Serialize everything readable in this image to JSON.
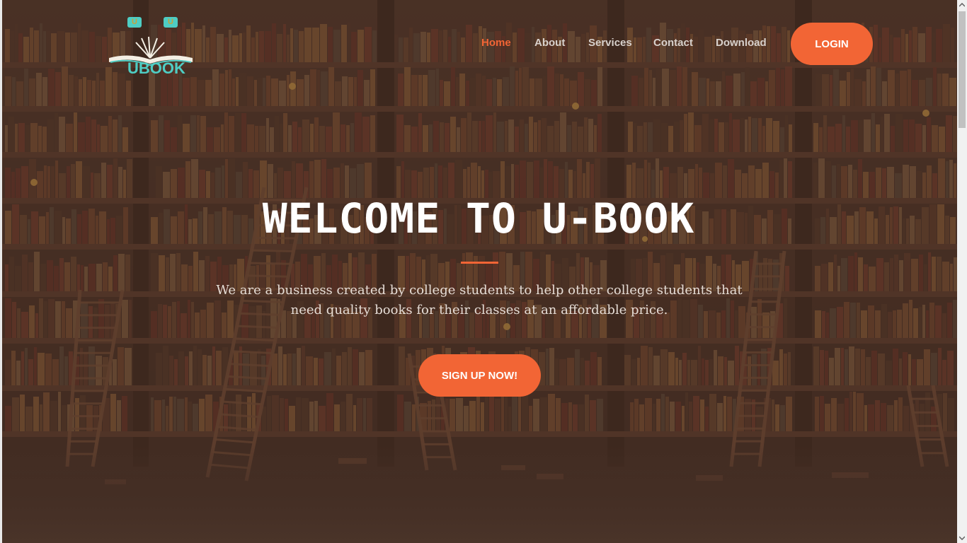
{
  "brand": {
    "logo_text": "UBOOK",
    "logo_tab_left": "U",
    "logo_tab_right": "U",
    "accent_color": "#f26535",
    "logo_color": "#4ecdc4"
  },
  "nav": {
    "items": [
      {
        "label": "Home",
        "active": true
      },
      {
        "label": "About",
        "active": false
      },
      {
        "label": "Services",
        "active": false
      },
      {
        "label": "Contact",
        "active": false
      },
      {
        "label": "Download",
        "active": false
      }
    ],
    "login_label": "LOGIN"
  },
  "hero": {
    "headline": "WELCOME TO U-BOOK",
    "tagline": "We are a business created by college students to help other college students that need quality books for their classes at an affordable price.",
    "cta_label": "SIGN UP NOW!",
    "background_icon": "library-bookshelves-image"
  },
  "scrollbar": {
    "up_icon": "chevron-up-icon",
    "down_icon": "chevron-down-icon"
  }
}
